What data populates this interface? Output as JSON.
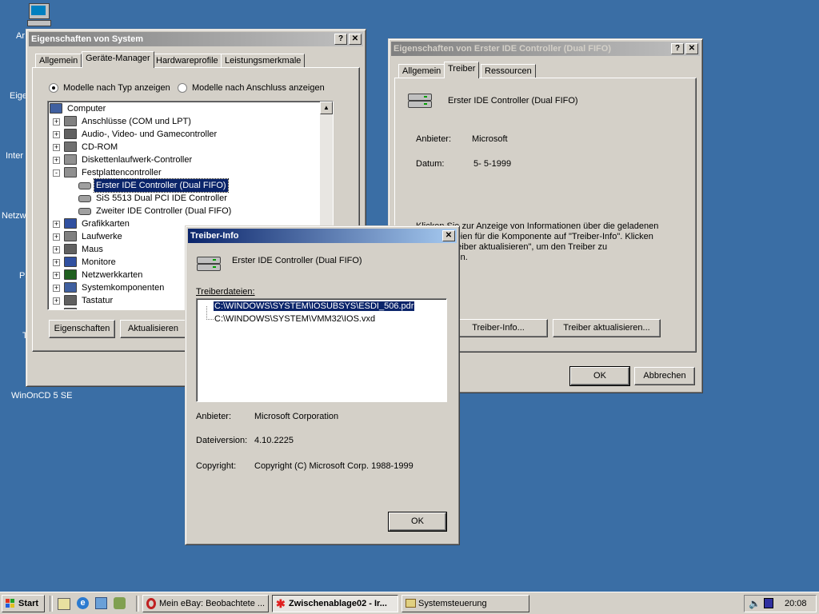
{
  "desktop": {
    "icons": [
      "Ar",
      "Eige",
      "Inter",
      "Netzw",
      "Pa",
      "T",
      "WinOnCD 5 SE"
    ]
  },
  "system_window": {
    "title": "Eigenschaften von System",
    "tabs": [
      "Allgemein",
      "Geräte-Manager",
      "Hardwareprofile",
      "Leistungsmerkmale"
    ],
    "radio_type": "Modelle nach Typ anzeigen",
    "radio_connection": "Modelle nach Anschluss anzeigen",
    "tree": [
      "Computer",
      "Anschlüsse (COM und LPT)",
      "Audio-, Video- und Gamecontroller",
      "CD-ROM",
      "Diskettenlaufwerk-Controller",
      "Festplattencontroller",
      "Erster IDE Controller (Dual FIFO)",
      "SiS 5513 Dual PCI IDE Controller",
      "Zweiter IDE Controller (Dual FIFO)",
      "Grafikkarten",
      "Laufwerke",
      "Maus",
      "Monitore",
      "Netzwerkkarten",
      "Systemkomponenten",
      "Tastatur",
      "Universal Image Mounter"
    ],
    "btn_properties": "Eigenschaften",
    "btn_refresh": "Aktualisieren"
  },
  "controller_window": {
    "title": "Eigenschaften von Erster IDE Controller (Dual FIFO)",
    "tabs": [
      "Allgemein",
      "Treiber",
      "Ressourcen"
    ],
    "device_name": "Erster IDE Controller (Dual FIFO)",
    "vendor_label": "Anbieter:",
    "vendor_value": "Microsoft",
    "date_label": "Datum:",
    "date_value": "5- 5-1999",
    "info_line1": "Klicken Sie zur Anzeige von Informationen über die geladenen",
    "info_line2": "Treiberdateien für die Komponente auf \"Treiber-Info\". Klicken",
    "info_line3": "Sie auf \"Treiber aktualisieren\", um den Treiber zu",
    "info_line4": "aktualisieren.",
    "btn_driver_info": "Treiber-Info...",
    "btn_update": "Treiber aktualisieren...",
    "btn_ok": "OK",
    "btn_cancel": "Abbrechen"
  },
  "driver_info": {
    "title": "Treiber-Info",
    "device_name": "Erster IDE Controller (Dual FIFO)",
    "files_label": "Treiberdateien:",
    "files": [
      "C:\\WINDOWS\\SYSTEM\\IOSUBSYS\\ESDI_506.pdr",
      "C:\\WINDOWS\\SYSTEM\\VMM32\\IOS.vxd"
    ],
    "vendor_label": "Anbieter:",
    "vendor_value": "Microsoft Corporation",
    "version_label": "Dateiversion:",
    "version_value": "4.10.2225",
    "copyright_label": "Copyright:",
    "copyright_value": "Copyright (C) Microsoft Corp. 1988-1999",
    "btn_ok": "OK"
  },
  "taskbar": {
    "start": "Start",
    "buttons": [
      "Mein eBay: Beobachtete ...",
      "Zwischenablage02 - Ir...",
      "Systemsteuerung"
    ],
    "clock": "20:08"
  },
  "colors": {
    "desktop": "#3a6ea5",
    "title_active": "#0a246a",
    "face": "#d4d0c8"
  }
}
